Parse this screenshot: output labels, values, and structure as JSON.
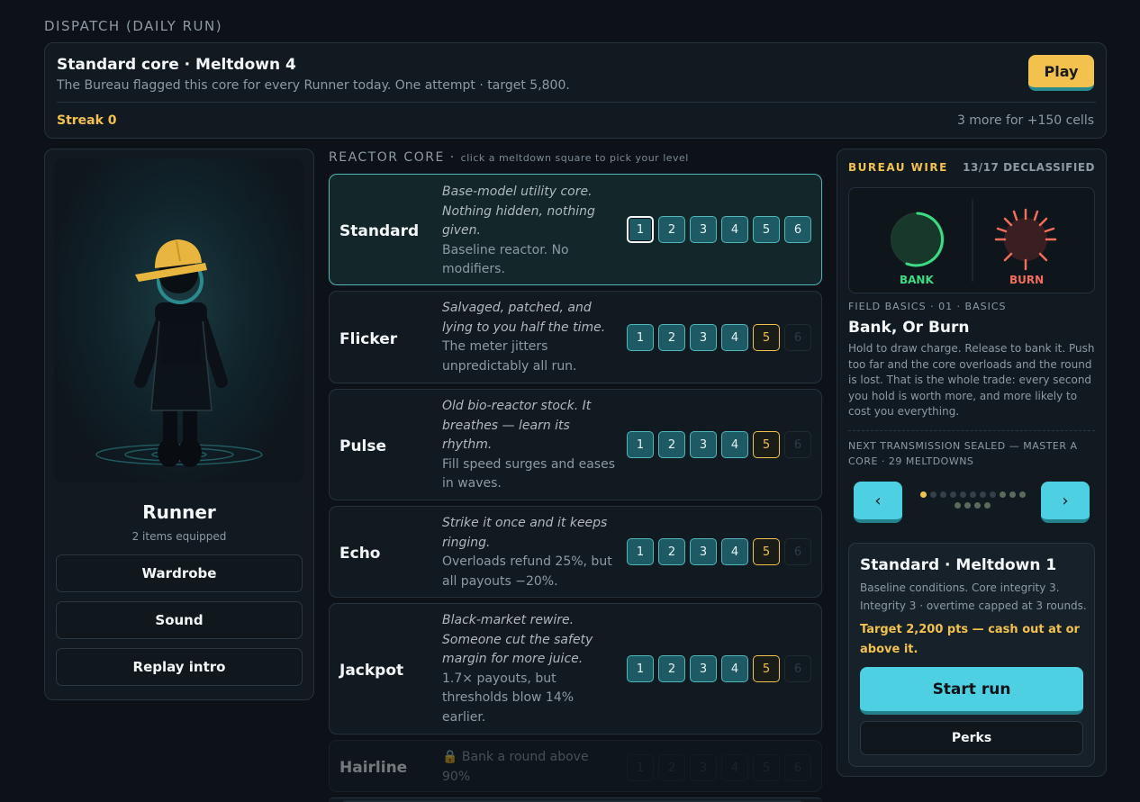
{
  "dispatch": {
    "section_label": "DISPATCH (DAILY RUN)",
    "title": "Standard core · Meltdown 4",
    "subtitle": "The Bureau flagged this core for every Runner today. One attempt · target 5,800.",
    "play_label": "Play",
    "streak": "Streak 0",
    "streak_more": "3 more for +150 cells"
  },
  "runner": {
    "name": "Runner",
    "items": "2 items equipped",
    "buttons": [
      "Wardrobe",
      "Sound",
      "Replay intro"
    ]
  },
  "core_section": {
    "label": "REACTOR CORE ·",
    "hint": "click a meltdown square to pick your level"
  },
  "cores": [
    {
      "name": "Standard",
      "flavor": "Base-model utility core. Nothing hidden, nothing given.",
      "desc": "Baseline reactor. No modifiers.",
      "levels": [
        "1",
        "2",
        "3",
        "4",
        "5",
        "6"
      ]
    },
    {
      "name": "Flicker",
      "flavor": "Salvaged, patched, and lying to you half the time.",
      "desc": "The meter jitters unpredictably all run.",
      "levels": [
        "1",
        "2",
        "3",
        "4",
        "5",
        "6"
      ]
    },
    {
      "name": "Pulse",
      "flavor": "Old bio-reactor stock. It breathes — learn its rhythm.",
      "desc": "Fill speed surges and eases in waves.",
      "levels": [
        "1",
        "2",
        "3",
        "4",
        "5",
        "6"
      ]
    },
    {
      "name": "Echo",
      "flavor": "Strike it once and it keeps ringing.",
      "desc": "Overloads refund 25%, but all payouts −20%.",
      "levels": [
        "1",
        "2",
        "3",
        "4",
        "5",
        "6"
      ]
    },
    {
      "name": "Jackpot",
      "flavor": "Black-market rewire. Someone cut the safety margin for more juice.",
      "desc": "1.7× payouts, but thresholds blow 14% earlier.",
      "levels": [
        "1",
        "2",
        "3",
        "4",
        "5",
        "6"
      ]
    },
    {
      "name": "Hairline",
      "flavor": "",
      "desc": "Bank a round above 90%",
      "levels": [
        "1",
        "2",
        "3",
        "4",
        "5",
        "6"
      ],
      "locked": true
    }
  ],
  "wire": {
    "title": "BUREAU WIRE",
    "count": "13/17 DECLASSIFIED",
    "bank_label": "BANK",
    "burn_label": "BURN",
    "kicker": "FIELD BASICS · 01 · BASICS",
    "headline": "Bank, Or Burn",
    "body": "Hold to draw charge. Release to bank it. Push too far and the core overloads and the round is lost. That is the whole trade: every second you hold is worth more, and more likely to cost you everything.",
    "next": "NEXT TRANSMISSION SEALED — MASTER A CORE · 29 MELTDOWNS",
    "prev_label": "‹",
    "next_label": "›",
    "dots_total": 15,
    "dots_active_index": 0
  },
  "run": {
    "title": "Standard · Meltdown 1",
    "desc": "Baseline conditions. Core integrity 3. Integrity 3 · overtime capped at 3 rounds.",
    "target": "Target 2,200 pts — cash out at or above it.",
    "start_label": "Start run",
    "perks_label": "Perks"
  },
  "colors": {
    "accent": "#4dd0e1",
    "gold": "#f2c14e",
    "bank": "#3ddc84",
    "burn": "#f26d5b"
  }
}
